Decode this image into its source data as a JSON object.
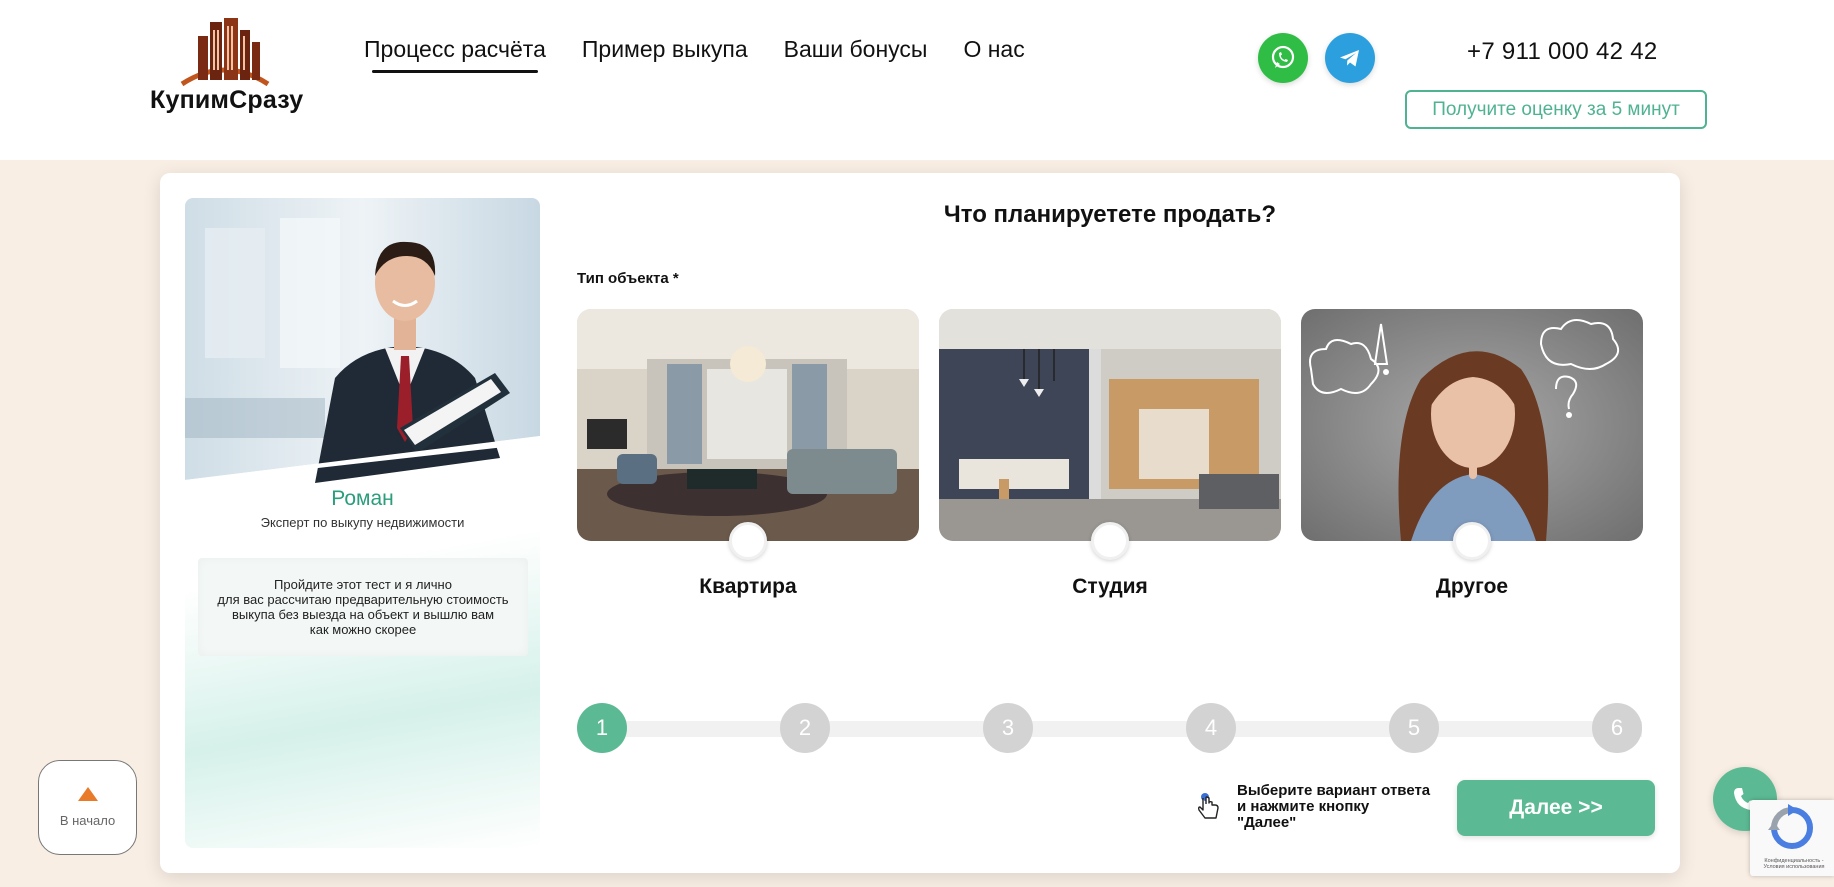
{
  "header": {
    "logo_text": "КупимСразу",
    "nav": [
      {
        "label": "Процесс расчёта",
        "active": true
      },
      {
        "label": "Пример выкупа",
        "active": false
      },
      {
        "label": "Ваши бонусы",
        "active": false
      },
      {
        "label": "О нас",
        "active": false
      }
    ],
    "social": [
      {
        "icon": "whatsapp-icon",
        "color": "#2fbd45"
      },
      {
        "icon": "telegram-icon",
        "color": "#2ca0de"
      }
    ],
    "phone": "+7 911 000 42 42",
    "cta_label": "Получите оценку за 5 минут"
  },
  "expert": {
    "name": "Роман",
    "role": "Эксперт по выкупу недвижимости",
    "note": "Пройдите этот тест и я лично\nдля вас рассчитаю предварительную стоимость\nвыкупа без выезда на объект и вышлю вам\nкак можно скорее"
  },
  "quiz": {
    "question": "Что планируетете продать?",
    "field_label": "Тип объекта *",
    "options": [
      {
        "label": "Квартира",
        "selected": false
      },
      {
        "label": "Студия",
        "selected": false
      },
      {
        "label": "Другое",
        "selected": false
      }
    ],
    "steps": [
      "1",
      "2",
      "3",
      "4",
      "5",
      "6"
    ],
    "current_step": 1,
    "hint": "Выберите вариант ответа\nи нажмите кнопку\n\"Далее\"",
    "next_label": "Далее  >>"
  },
  "floating": {
    "to_top_label": "В начало",
    "recaptcha_text": "Конфиденциальность -\nУсловия использования"
  },
  "colors": {
    "accent": "#5bba93",
    "accent_text": "#2a9d7c",
    "page_bg": "#f8eee4",
    "logo_brown": "#7a2a12",
    "to_top_arrow": "#e87a2a"
  }
}
